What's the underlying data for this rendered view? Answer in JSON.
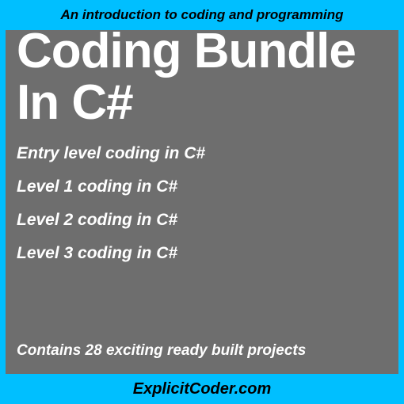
{
  "banner": {
    "top": "An introduction to coding and programming",
    "bottom": "ExplicitCoder.com"
  },
  "title": "Coding Bundle In C#",
  "levels": [
    "Entry level coding in C#",
    "Level 1 coding in C#",
    "Level 2 coding in C#",
    "Level 3 coding in C#"
  ],
  "projects_line": "Contains 28 exciting ready built projects"
}
